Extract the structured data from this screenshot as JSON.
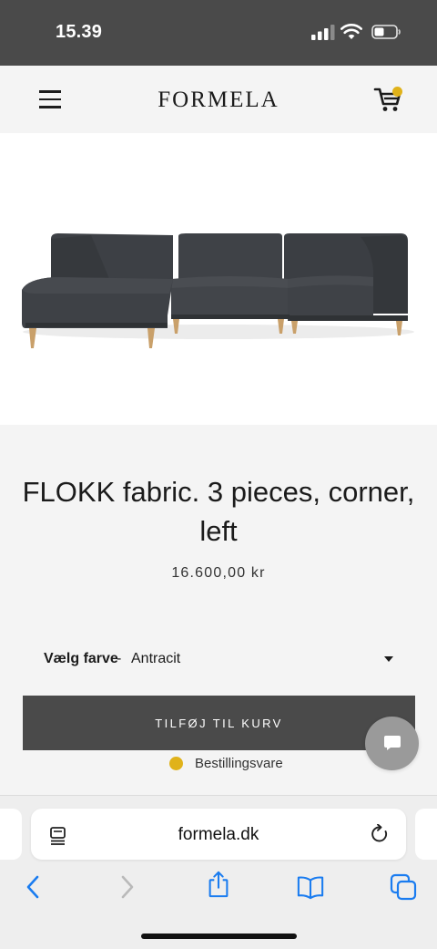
{
  "status_bar": {
    "time": "15.39"
  },
  "header": {
    "logo": "FORMELA"
  },
  "product": {
    "title": "FLOKK fabric. 3 pieces, corner, left",
    "price": "16.600,00 kr",
    "color_label": "Vælg farve",
    "color_separator": "-",
    "color_value": "Antracit",
    "add_to_cart_label": "TILFØJ TIL KURV",
    "availability": "Bestillingsvare"
  },
  "browser": {
    "url": "formela.dk"
  },
  "colors": {
    "status_bar_bg": "#4a4a4a",
    "accent_yellow": "#e0b21a",
    "button_bg": "#4a4a4a",
    "sofa_fabric": "#3b3e42",
    "ios_blue": "#1a7cf0"
  },
  "icons": {
    "menu": "hamburger-menu-icon",
    "cart": "shopping-cart-icon",
    "chat": "chat-bubble-icon",
    "reader": "reader-view-icon",
    "reload": "reload-icon",
    "back": "chevron-left-icon",
    "forward": "chevron-right-icon",
    "share": "share-icon",
    "bookmarks": "book-icon",
    "tabs": "tabs-icon"
  }
}
